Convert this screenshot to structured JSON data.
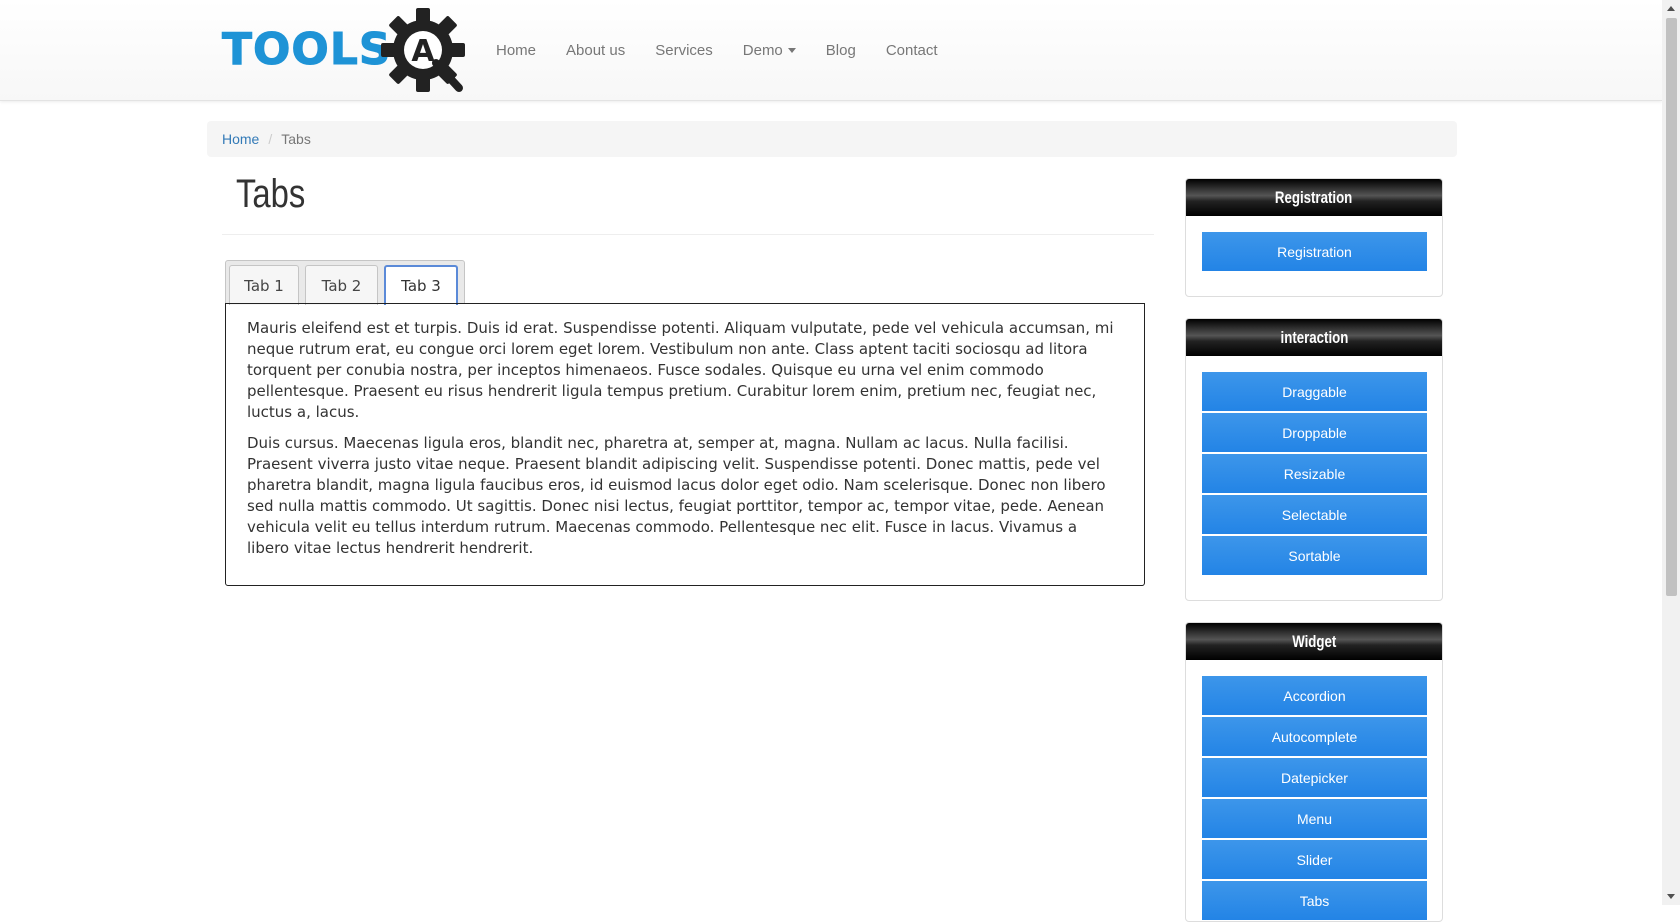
{
  "logo": {
    "text": "TOOLS",
    "badge_letter": "A"
  },
  "nav": {
    "items": [
      {
        "label": "Home"
      },
      {
        "label": "About us"
      },
      {
        "label": "Services"
      },
      {
        "label": "Demo",
        "has_caret": true
      },
      {
        "label": "Blog"
      },
      {
        "label": "Contact"
      }
    ]
  },
  "breadcrumb": {
    "home": "Home",
    "separator": "/",
    "current": "Tabs"
  },
  "page_title": "Tabs",
  "tabs": [
    {
      "label": "Tab 1",
      "active": false
    },
    {
      "label": "Tab 2",
      "active": false
    },
    {
      "label": "Tab 3",
      "active": true
    }
  ],
  "panel": {
    "paragraphs": [
      "Mauris eleifend est et turpis. Duis id erat. Suspendisse potenti. Aliquam vulputate, pede vel vehicula accumsan, mi neque rutrum erat, eu congue orci lorem eget lorem. Vestibulum non ante. Class aptent taciti sociosqu ad litora torquent per conubia nostra, per inceptos himenaeos. Fusce sodales. Quisque eu urna vel enim commodo pellentesque. Praesent eu risus hendrerit ligula tempus pretium. Curabitur lorem enim, pretium nec, feugiat nec, luctus a, lacus.",
      "Duis cursus. Maecenas ligula eros, blandit nec, pharetra at, semper at, magna. Nullam ac lacus. Nulla facilisi. Praesent viverra justo vitae neque. Praesent blandit adipiscing velit. Suspendisse potenti. Donec mattis, pede vel pharetra blandit, magna ligula faucibus eros, id euismod lacus dolor eget odio. Nam scelerisque. Donec non libero sed nulla mattis commodo. Ut sagittis. Donec nisi lectus, feugiat porttitor, tempor ac, tempor vitae, pede. Aenean vehicula velit eu tellus interdum rutrum. Maecenas commodo. Pellentesque nec elit. Fusce in lacus. Vivamus a libero vitae lectus hendrerit hendrerit."
    ]
  },
  "sidebar": {
    "widgets": [
      {
        "title": "Registration",
        "buttons": [
          "Registration"
        ]
      },
      {
        "title": "interaction",
        "buttons": [
          "Draggable",
          "Droppable",
          "Resizable",
          "Selectable",
          "Sortable"
        ]
      },
      {
        "title": "Widget",
        "buttons": [
          "Accordion",
          "Autocomplete",
          "Datepicker",
          "Menu",
          "Slider",
          "Tabs"
        ]
      }
    ]
  },
  "colors": {
    "brand_blue": "#1e93d6",
    "button_blue": "#2384e6",
    "link_blue": "#337ab7",
    "active_tab_border": "#5b8ad8"
  }
}
